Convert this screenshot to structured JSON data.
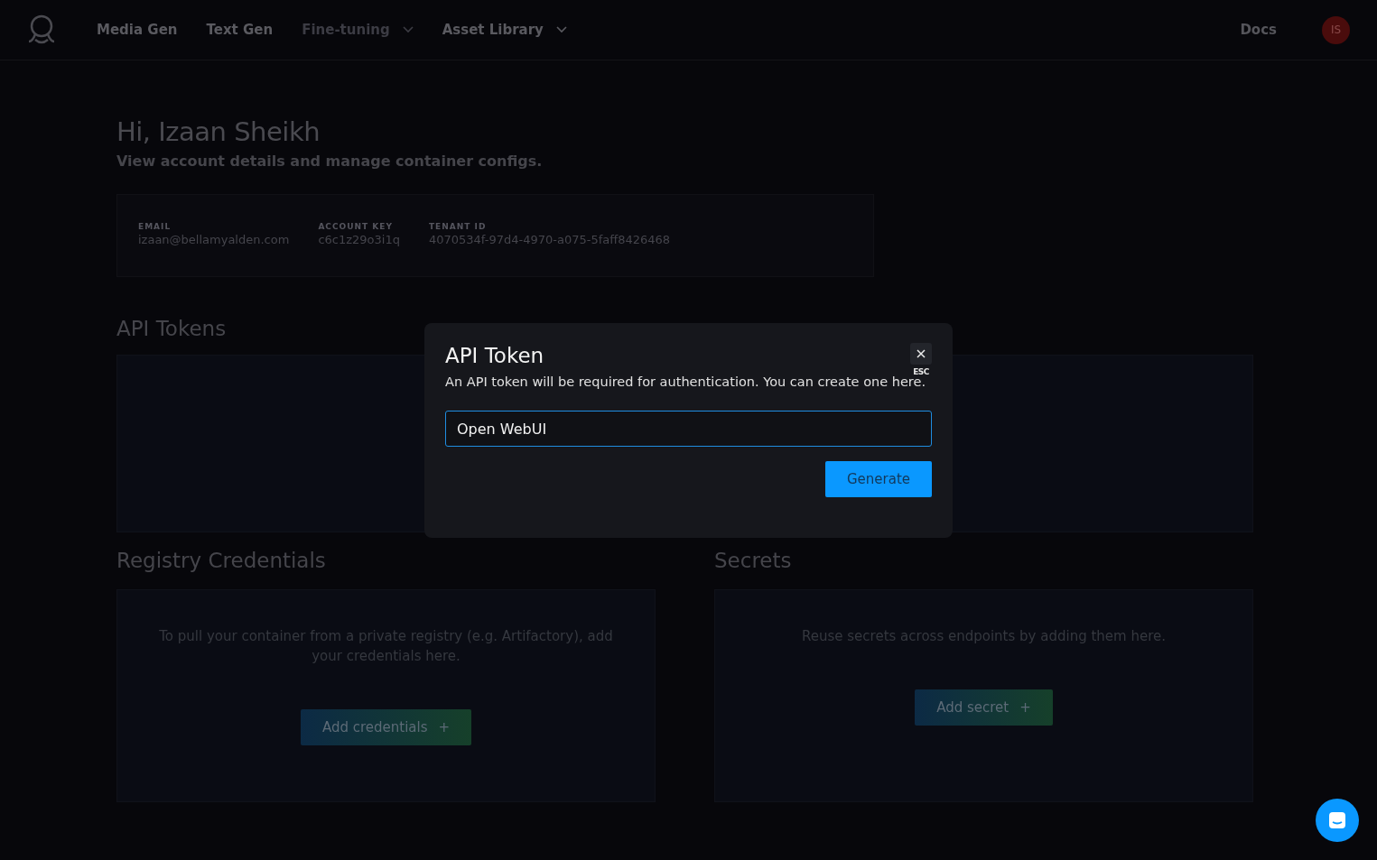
{
  "nav": {
    "items": [
      {
        "label": "Media Gen",
        "disabled": false,
        "dropdown": false
      },
      {
        "label": "Text Gen",
        "disabled": false,
        "dropdown": false
      },
      {
        "label": "Fine-tuning",
        "disabled": true,
        "dropdown": true
      },
      {
        "label": "Asset Library",
        "disabled": false,
        "dropdown": true
      }
    ],
    "docs": "Docs",
    "avatar": "IS"
  },
  "greeting": {
    "title": "Hi, Izaan Sheikh",
    "subtitle": "View account details and manage container configs."
  },
  "account": [
    {
      "label": "EMAIL",
      "value": "izaan@bellamyalden.com"
    },
    {
      "label": "ACCOUNT KEY",
      "value": "c6c1z29o3i1q"
    },
    {
      "label": "TENANT ID",
      "value": "4070534f-97d4-4970-a075-5faff8426468"
    }
  ],
  "api_tokens": {
    "title": "API Tokens"
  },
  "registry": {
    "title": "Registry Credentials",
    "text": "To pull your container from a private registry (e.g. Artifactory), add your credentials here.",
    "button": "Add credentials",
    "button_icon": "+"
  },
  "secrets": {
    "title": "Secrets",
    "text": "Reuse secrets across endpoints by adding them here.",
    "button": "Add secret",
    "button_icon": "+"
  },
  "modal": {
    "title": "API Token",
    "close_hint": "ESC",
    "description": "An API token will be required for authentication. You can create one here.",
    "input": {
      "value": "Open WebUI"
    },
    "button": "Generate"
  }
}
